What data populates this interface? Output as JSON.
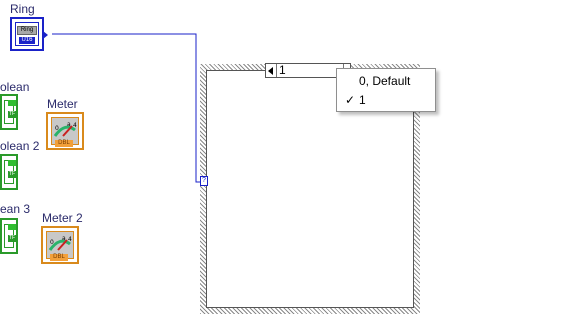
{
  "block_diagram": {
    "ring": {
      "label": "Ring",
      "chip_text": "Ring",
      "type_badge": "U16"
    },
    "booleans": [
      {
        "label": "olean",
        "badge": "TF"
      },
      {
        "label": "olean 2",
        "badge": "TF"
      },
      {
        "label": "ean 3",
        "badge": "TF"
      }
    ],
    "meters": [
      {
        "label": "Meter",
        "badge": "DBL"
      },
      {
        "label": "Meter 2",
        "badge": "DBL"
      }
    ],
    "case_structure": {
      "selector_value": "1",
      "selector_terminal_glyph": "?",
      "menu_items": [
        {
          "label": "0, Default",
          "checked": false
        },
        {
          "label": "1",
          "checked": true
        }
      ],
      "checkmark": "✓"
    },
    "colors": {
      "ring_blue": "#1a22c8",
      "boolean_green": "#2a9a2a",
      "meter_orange": "#d98a1c",
      "case_border": "#7a7a7a"
    }
  }
}
